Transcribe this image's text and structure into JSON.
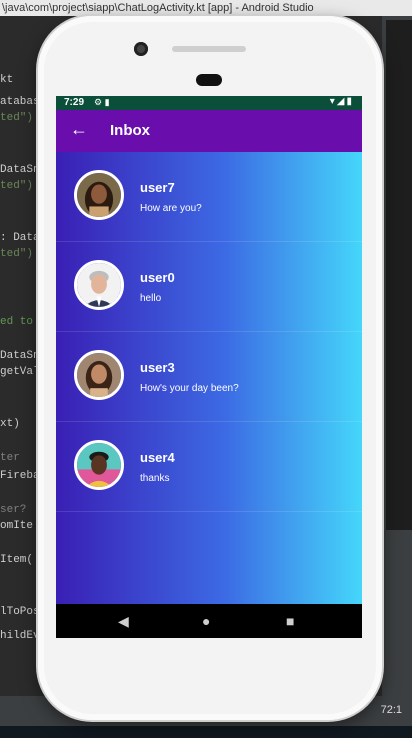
{
  "ide": {
    "title": "\\java\\com\\project\\siapp\\ChatLogActivity.kt [app] - Android Studio",
    "code_lines": [
      "kt",
      "atabas",
      "ted\")",
      "DataSn",
      "ted\")",
      ": Data",
      "ted\")",
      "ed to",
      "DataSn",
      "getVal",
      "xt)",
      "ter",
      "Fireba",
      "ser?",
      "omIte",
      "Item(",
      "lToPos",
      "hildEve"
    ],
    "cursor_pos": "72:1"
  },
  "status_bar": {
    "time": "7:29"
  },
  "app_bar": {
    "title": "Inbox"
  },
  "conversations": [
    {
      "user": "user7",
      "message": "How are you?"
    },
    {
      "user": "user0",
      "message": "hello"
    },
    {
      "user": "user3",
      "message": "How's your day been?"
    },
    {
      "user": "user4",
      "message": "thanks"
    }
  ],
  "colors": {
    "app_bar": "#6a0dad",
    "status_bar": "#0b4f3a",
    "gradient_start": "#3a1fb5",
    "gradient_end": "#45d6fa"
  }
}
